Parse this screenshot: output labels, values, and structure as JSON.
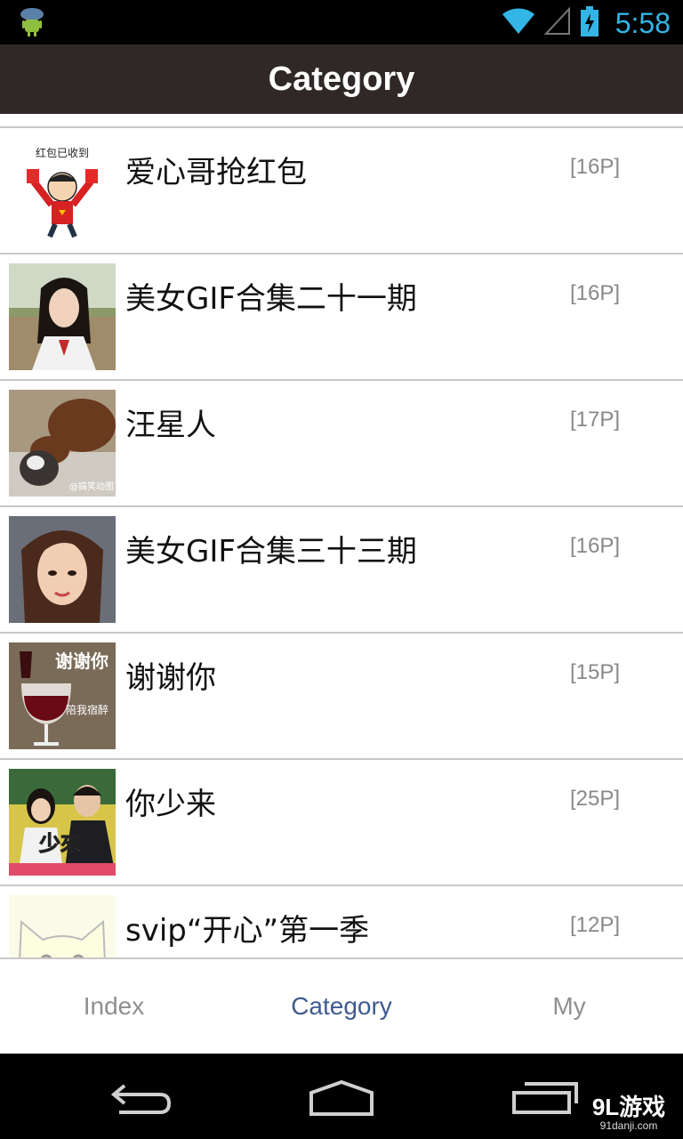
{
  "status_bar": {
    "time": "5:58",
    "icons": [
      "android-debug-icon",
      "wifi-icon",
      "signal-icon",
      "battery-charging-icon"
    ]
  },
  "header": {
    "title": "Category"
  },
  "list": {
    "items": [
      {
        "title": "爱心哥抢红包",
        "count": "[16P]",
        "thumb": "cartoon-red-envelope",
        "thumb_text": "红包已收到"
      },
      {
        "title": "美女GIF合集二十一期",
        "count": "[16P]",
        "thumb": "girl-school-uniform"
      },
      {
        "title": "汪星人",
        "count": "[17P]",
        "thumb": "dog-and-cat",
        "thumb_text": "@搞笑动图"
      },
      {
        "title": "美女GIF合集三十三期",
        "count": "[16P]",
        "thumb": "girl-portrait"
      },
      {
        "title": "谢谢你",
        "count": "[15P]",
        "thumb": "wine-glass",
        "thumb_text": "谢谢你",
        "thumb_text2": "陪我宿醉"
      },
      {
        "title": "你少来",
        "count": "[25P]",
        "thumb": "tv-show-hosts",
        "thumb_text": "少來"
      },
      {
        "title": "svip“开心”第一季",
        "count": "[12P]",
        "thumb": "cartoon-cat"
      }
    ]
  },
  "tab_bar": {
    "tabs": [
      {
        "label": "Index",
        "active": false
      },
      {
        "label": "Category",
        "active": true
      },
      {
        "label": "My",
        "active": false
      }
    ],
    "active_color": "#3f5a8f",
    "inactive_color": "#8f8f8f"
  },
  "nav_bar": {
    "buttons": [
      "back-icon",
      "home-icon",
      "recent-apps-icon"
    ]
  },
  "watermark": {
    "main": "9L游戏",
    "sub": "91danji.com"
  },
  "colors": {
    "header_bg": "#2f2826",
    "status_accent": "#33b5e5"
  }
}
